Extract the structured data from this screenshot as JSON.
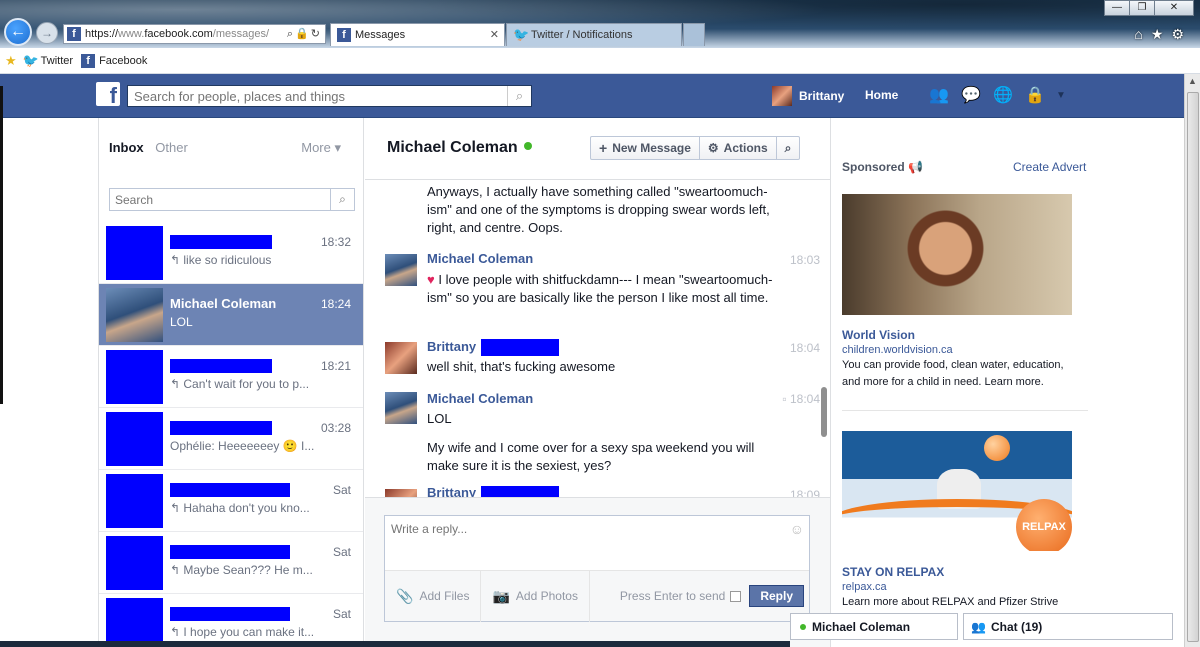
{
  "browser": {
    "url_prefix": "https://",
    "url_domain_gray": "www.",
    "url_domain": "facebook.com",
    "url_path": "/messages/",
    "tabs": [
      {
        "label": "Messages",
        "active": true
      },
      {
        "label": "Twitter / Notifications",
        "active": false
      }
    ],
    "favorites": [
      {
        "label": "Twitter"
      },
      {
        "label": "Facebook"
      }
    ]
  },
  "fb": {
    "search_placeholder": "Search for people, places and things",
    "user_name": "Brittany",
    "home_label": "Home"
  },
  "inbox": {
    "tab_inbox": "Inbox",
    "tab_other": "Other",
    "more_label": "More ▾",
    "search_placeholder": "Search",
    "threads": [
      {
        "name": "",
        "time": "18:32",
        "snippet": "↰ like so ridiculous",
        "selected": false
      },
      {
        "name": "Michael Coleman",
        "time": "18:24",
        "snippet": "LOL",
        "selected": true
      },
      {
        "name": "",
        "time": "18:21",
        "snippet": "↰ Can't wait for you to p...",
        "selected": false
      },
      {
        "name": "",
        "time": "03:28",
        "snippet": "Ophélie: Heeeeeeey 🙂 I...",
        "selected": false
      },
      {
        "name": "",
        "time": "Sat",
        "snippet": "↰ Hahaha don't you kno...",
        "selected": false
      },
      {
        "name": "",
        "time": "Sat",
        "snippet": "↰ Maybe Sean??? He m...",
        "selected": false
      },
      {
        "name": "",
        "time": "Sat",
        "snippet": "↰ I hope you can make it...",
        "selected": false
      }
    ]
  },
  "conversation": {
    "title": "Michael Coleman",
    "new_message_label": "New Message",
    "actions_label": "Actions",
    "messages": [
      {
        "sender": "",
        "time": "",
        "text": "Anyways, I actually have something called \"sweartoomuch-ism\" and one of the symptoms is dropping swear words left, right, and centre. Oops."
      },
      {
        "sender": "Michael Coleman",
        "time": "18:03",
        "text": "I love people with shitfuckdamn--- I mean \"sweartoomuch-ism\" so you are basically like the person I like most all time."
      },
      {
        "sender": "Brittany",
        "time": "18:04",
        "text": "well shit, that's fucking awesome"
      },
      {
        "sender": "Michael Coleman",
        "time": "18:04",
        "text": "LOL"
      },
      {
        "sender": "",
        "time": "",
        "text": "My wife and I come over for a sexy spa weekend you will make sure it is the sexiest, yes?"
      },
      {
        "sender": "Brittany",
        "time": "18:09",
        "text": ""
      }
    ],
    "reply_placeholder": "Write a reply...",
    "add_files_label": "Add Files",
    "add_photos_label": "Add Photos",
    "press_enter_label": "Press Enter to send",
    "reply_label": "Reply"
  },
  "ads": {
    "sponsored_label": "Sponsored",
    "create_advert_label": "Create Advert",
    "items": [
      {
        "title": "World Vision",
        "url": "children.worldvision.ca",
        "body": "You can provide food, clean water, education, and more for a child in need. Learn more."
      },
      {
        "title": "STAY ON RELPAX",
        "url": "relpax.ca",
        "body": "Learn more about RELPAX and Pfizer Strive"
      }
    ],
    "relpax_badge": "RELPAX"
  },
  "chat": {
    "open_chat_name": "Michael Coleman",
    "chat_label": "Chat (19)"
  },
  "colors": {
    "fb_blue": "#3b5998",
    "selected_thread": "#6d84b4",
    "redaction": "#0000ff",
    "online_green": "#42b72a"
  }
}
